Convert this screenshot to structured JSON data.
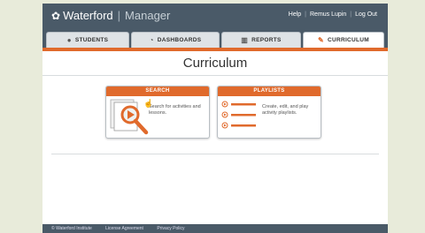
{
  "header": {
    "brand": "Waterford",
    "product": "Manager",
    "links": [
      "Help",
      "Remus Lupin",
      "Log Out"
    ]
  },
  "tabs": [
    {
      "label": "STUDENTS",
      "icon": "students-icon"
    },
    {
      "label": "DASHBOARDS",
      "icon": "dashboards-icon"
    },
    {
      "label": "REPORTS",
      "icon": "reports-icon"
    },
    {
      "label": "CURRICULUM",
      "icon": "curriculum-icon",
      "active": true
    }
  ],
  "page": {
    "title": "Curriculum"
  },
  "cards": {
    "search": {
      "header": "SEARCH",
      "text": "Search for activities and lessons."
    },
    "playlists": {
      "header": "PLAYLISTS",
      "text": "Create, edit, and play activity playlists."
    }
  },
  "footer": {
    "items": [
      "© Waterford Institute",
      "License Agreement",
      "Privacy Policy"
    ]
  },
  "colors": {
    "accent": "#e06a2c",
    "topbar": "#4a5a68",
    "page_bg": "#e8ebda"
  }
}
